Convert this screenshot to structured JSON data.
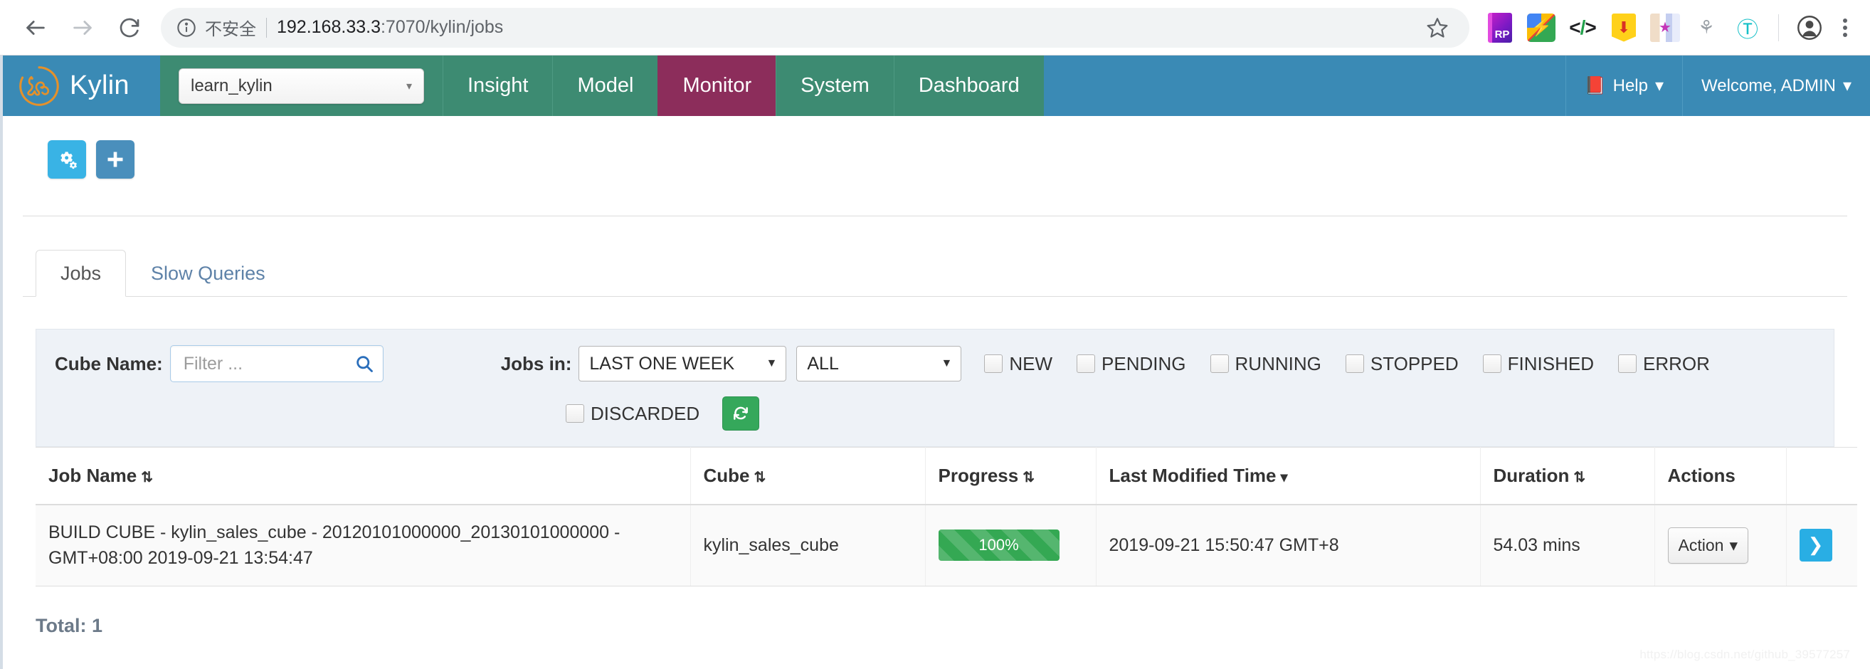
{
  "browser": {
    "back_label": "back-arrow",
    "forward_label": "forward-arrow",
    "reload_label": "reload",
    "security_text": "不安全",
    "url_host": "192.168.33.3",
    "url_path": ":7070/kylin/jobs",
    "bookmark_label": "star",
    "extensions": [
      "rp-extension",
      "lanzou-extension",
      "code-extension",
      "download-extension",
      "bookmark-extension",
      "sitemap-extension",
      "t-extension"
    ],
    "profile_label": "profile",
    "menu_label": "chrome-menu"
  },
  "navbar": {
    "brand": "Kylin",
    "project": "learn_kylin",
    "items": [
      {
        "label": "Insight",
        "active": false
      },
      {
        "label": "Model",
        "active": false
      },
      {
        "label": "Monitor",
        "active": true
      },
      {
        "label": "System",
        "active": false
      },
      {
        "label": "Dashboard",
        "active": false
      }
    ],
    "help": "Help",
    "user": "Welcome, ADMIN",
    "caret": "▾",
    "colors": {
      "brand_bg": "#3a8ab5",
      "nav_bg": "#3d8b72",
      "active_bg": "#8c2d5b"
    }
  },
  "toolbar": {
    "settings_icon": "cogs-icon",
    "add_icon": "plus-icon"
  },
  "tabs": [
    {
      "label": "Jobs",
      "active": true
    },
    {
      "label": "Slow Queries",
      "active": false
    }
  ],
  "filters": {
    "cube_name_label": "Cube Name:",
    "cube_name_value": "",
    "cube_name_placeholder": "Filter ...",
    "jobs_in_label": "Jobs in:",
    "time_range": "LAST ONE WEEK",
    "status_select": "ALL",
    "caret": "▼",
    "statuses": [
      {
        "label": "NEW",
        "checked": false
      },
      {
        "label": "PENDING",
        "checked": false
      },
      {
        "label": "RUNNING",
        "checked": false
      },
      {
        "label": "STOPPED",
        "checked": false
      },
      {
        "label": "FINISHED",
        "checked": false
      },
      {
        "label": "ERROR",
        "checked": false
      }
    ],
    "discarded": {
      "label": "DISCARDED",
      "checked": false
    },
    "refresh_icon": "↻"
  },
  "table": {
    "columns": [
      {
        "label": "Job Name",
        "sort": "⇅"
      },
      {
        "label": "Cube",
        "sort": "⇅"
      },
      {
        "label": "Progress",
        "sort": "⇅"
      },
      {
        "label": "Last Modified Time",
        "sort": "▾"
      },
      {
        "label": "Duration",
        "sort": "⇅"
      },
      {
        "label": "Actions",
        "sort": ""
      }
    ],
    "rows": [
      {
        "job_name": "BUILD CUBE - kylin_sales_cube - 20120101000000_20130101000000 - GMT+08:00 2019-09-21 13:54:47",
        "cube": "kylin_sales_cube",
        "progress": "100%",
        "progress_value": 100,
        "last_modified": "2019-09-21 15:50:47 GMT+8",
        "duration": "54.03 mins",
        "action_label": "Action",
        "action_caret": "▾",
        "drill_icon": "❯"
      }
    ]
  },
  "footer": {
    "total": "Total: 1",
    "watermark": "https://blog.csdn.net/github_39577257"
  }
}
